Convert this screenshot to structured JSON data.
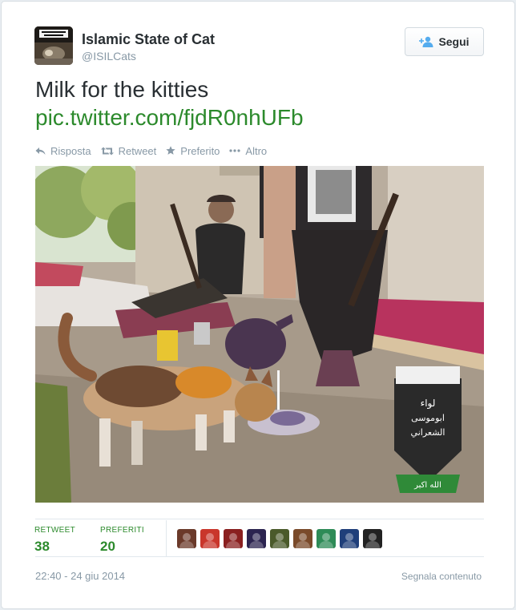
{
  "author": {
    "name": "Islamic State of Cat",
    "handle": "@ISILCats"
  },
  "follow_button": {
    "label": "Segui",
    "icon": "add-user-icon"
  },
  "tweet": {
    "text": "Milk for the kitties",
    "link": "pic.twitter.com/fjdR0nhUFb"
  },
  "actions": [
    {
      "label": "Risposta",
      "icon": "reply-icon"
    },
    {
      "label": "Retweet",
      "icon": "retweet-icon"
    },
    {
      "label": "Preferito",
      "icon": "star-icon"
    },
    {
      "label": "Altro",
      "icon": "more-icon"
    }
  ],
  "media": {
    "emblem_lines": [
      "لواء",
      "ابوموسى",
      "الشعراني"
    ],
    "emblem_banner": "الله اكبر"
  },
  "stats": {
    "retweets_label": "RETWEET",
    "retweets_count": "38",
    "favorites_label": "PREFERITI",
    "favorites_count": "20"
  },
  "favoriting_users": [
    {
      "icon": "user-avatar",
      "color": "#6b3a2a"
    },
    {
      "icon": "user-avatar",
      "color": "#c9362b"
    },
    {
      "icon": "user-avatar",
      "color": "#8a1f1f"
    },
    {
      "icon": "user-avatar",
      "color": "#2c2450"
    },
    {
      "icon": "user-avatar",
      "color": "#4a5a2a"
    },
    {
      "icon": "user-avatar",
      "color": "#7a4a2a"
    },
    {
      "icon": "user-avatar",
      "color": "#2e8b57"
    },
    {
      "icon": "user-avatar",
      "color": "#1f3f7a"
    },
    {
      "icon": "user-avatar",
      "color": "#222222"
    }
  ],
  "timestamp": "22:40 - 24 giu 2014",
  "report_link": "Segnala contenuto",
  "colors": {
    "link_green": "#2c8a2c",
    "muted_gray": "#8899a6",
    "text": "#292f33"
  }
}
